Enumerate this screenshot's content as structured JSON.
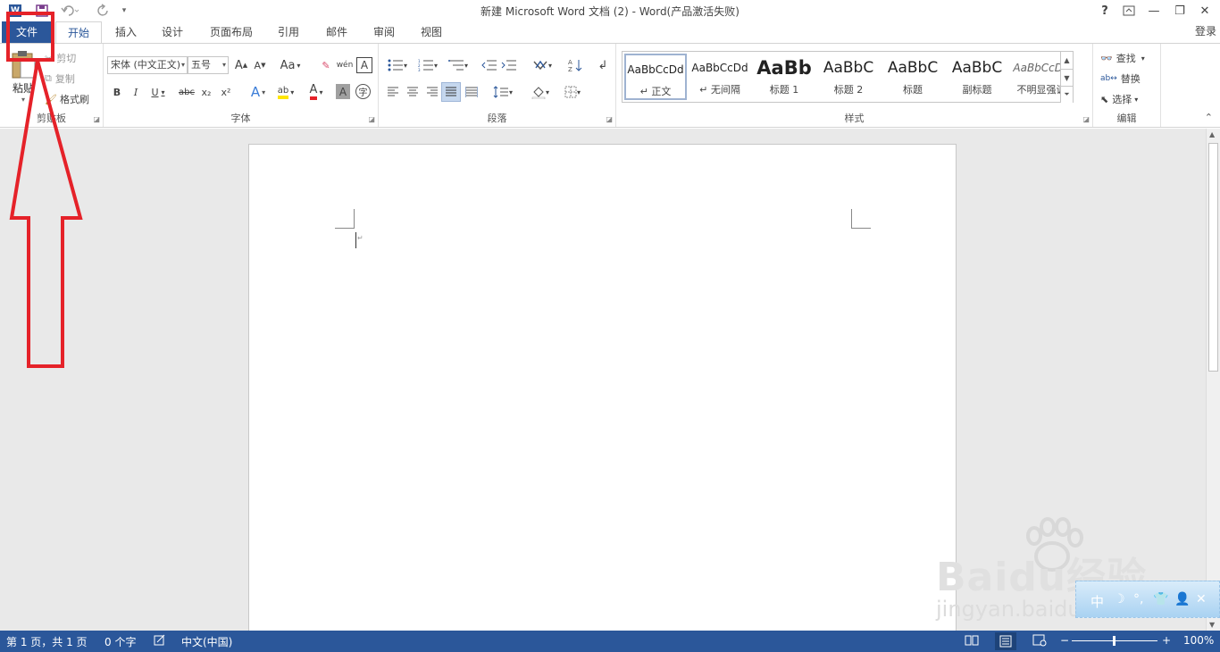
{
  "window": {
    "title": "新建 Microsoft Word 文档 (2) - Word(产品激活失败)",
    "help": "?",
    "minimize": "—",
    "maximize": "❐",
    "close": "✕"
  },
  "qat": {
    "app_icon": "W",
    "save_icon": "floppy-icon",
    "undo_icon": "undo-icon",
    "redo_icon": "redo-icon"
  },
  "tabs": [
    {
      "label": "文件"
    },
    {
      "label": "开始"
    },
    {
      "label": "插入"
    },
    {
      "label": "设计"
    },
    {
      "label": "页面布局"
    },
    {
      "label": "引用"
    },
    {
      "label": "邮件"
    },
    {
      "label": "审阅"
    },
    {
      "label": "视图"
    }
  ],
  "login": "登录",
  "clipboard": {
    "paste": "粘贴",
    "cut": "剪切",
    "copy": "复制",
    "format_painter": "格式刷",
    "group": "剪贴板"
  },
  "font": {
    "name": "宋体 (中文正文)",
    "size": "五号",
    "group": "字体",
    "grow": "A",
    "shrink": "A",
    "case": "Aa",
    "clear": "✎",
    "phonetic": "wén",
    "border_char": "A",
    "bold": "B",
    "italic": "I",
    "underline": "U",
    "strike": "abc",
    "sub": "x₂",
    "sup": "x²",
    "effects": "A",
    "highlight": "ab",
    "color": "A",
    "shade": "A",
    "enclose": "字"
  },
  "paragraph": {
    "group": "段落"
  },
  "styles": {
    "group": "样式",
    "items": [
      {
        "sample": "AaBbCcDd",
        "name": "↵ 正文"
      },
      {
        "sample": "AaBbCcDd",
        "name": "↵ 无间隔"
      },
      {
        "sample": "AaBb",
        "name": "标题 1"
      },
      {
        "sample": "AaBbC",
        "name": "标题 2"
      },
      {
        "sample": "AaBbC",
        "name": "标题"
      },
      {
        "sample": "AaBbC",
        "name": "副标题"
      },
      {
        "sample": "AaBbCcDd",
        "name": "不明显强调"
      }
    ]
  },
  "editing": {
    "group": "编辑",
    "find": "查找",
    "replace": "替换",
    "select": "选择"
  },
  "status": {
    "page": "第 1 页，共 1 页",
    "words": "0 个字",
    "lang": "中文(中国)",
    "zoom": "100%",
    "zoom_minus": "−",
    "zoom_plus": "+"
  },
  "watermark": {
    "brand": "Baidu经验",
    "url": "jingyan.baidu.com",
    "ime": "中"
  },
  "colors": {
    "accent": "#2b579a",
    "annotation": "#e52229"
  }
}
